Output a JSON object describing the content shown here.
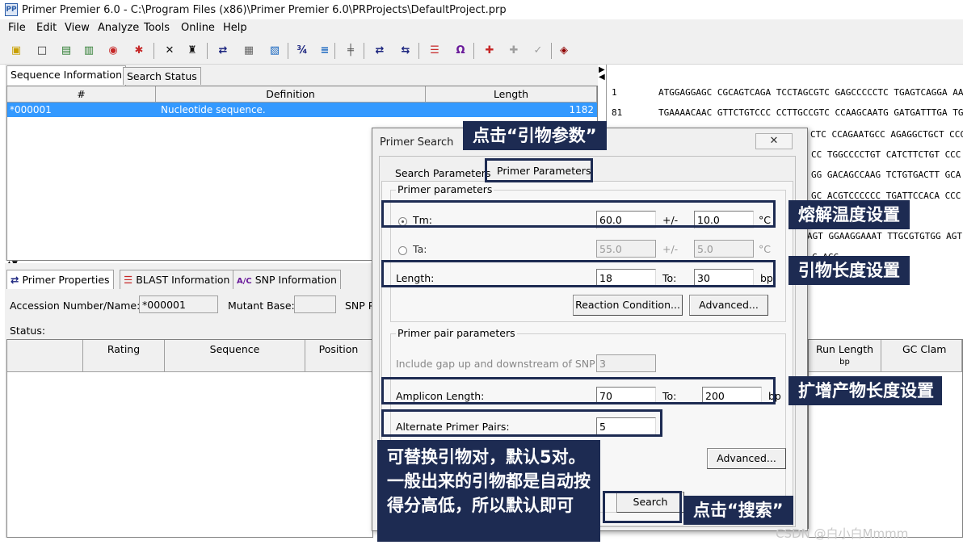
{
  "window": {
    "title": "Primer Premier 6.0 - C:\\Program Files (x86)\\Primer Premier 6.0\\PRProjects\\DefaultProject.prp",
    "app_icon_label": "PP"
  },
  "menu": [
    "File",
    "Edit",
    "View",
    "Analyze",
    "Tools",
    "Online",
    "Help"
  ],
  "toolbar_icons": [
    {
      "name": "open-folder-icon",
      "glyph": "▣",
      "color": "#c8a000"
    },
    {
      "name": "new-file-icon",
      "glyph": "□",
      "color": "#333333"
    },
    {
      "name": "open-icon",
      "glyph": "▤",
      "color": "#2e7d32"
    },
    {
      "name": "save-icon",
      "glyph": "▥",
      "color": "#2e7d32"
    },
    {
      "name": "genbank-icon",
      "glyph": "◉",
      "color": "#c62828"
    },
    {
      "name": "snp-db-icon",
      "glyph": "✱",
      "color": "#c62828"
    },
    {
      "name": "delete-icon",
      "glyph": "✕",
      "color": "#111111"
    },
    {
      "name": "find-icon",
      "glyph": "♜",
      "color": "#111111"
    },
    {
      "name": "align-icon",
      "glyph": "⇄",
      "color": "#1a237e"
    },
    {
      "name": "edit-seq-icon",
      "glyph": "▦",
      "color": "#666666"
    },
    {
      "name": "translate-icon",
      "glyph": "▧",
      "color": "#1565c0"
    },
    {
      "name": "ratio-icon",
      "glyph": "¾",
      "color": "#1a237e"
    },
    {
      "name": "gag-ctg-icon",
      "glyph": "≡",
      "color": "#1565c0"
    },
    {
      "name": "tree-icon",
      "glyph": "╪",
      "color": "#555555"
    },
    {
      "name": "primer-pair-icon",
      "glyph": "⇄",
      "color": "#1a237e"
    },
    {
      "name": "primer-search-icon",
      "glyph": "⇆",
      "color": "#1a237e"
    },
    {
      "name": "blast-icon",
      "glyph": "☰",
      "color": "#c62828"
    },
    {
      "name": "snp-analysis-icon",
      "glyph": "Ω",
      "color": "#6a1b9a"
    },
    {
      "name": "snp-red-icon",
      "glyph": "✚",
      "color": "#c62828"
    },
    {
      "name": "snp-gray-icon",
      "glyph": "✚",
      "color": "#9e9e9e"
    },
    {
      "name": "snp-check-icon",
      "glyph": "✓",
      "color": "#9e9e9e"
    },
    {
      "name": "book-icon",
      "glyph": "◈",
      "color": "#8e0000"
    }
  ],
  "seq_info": {
    "tabs": [
      "Sequence Information",
      "Search Status"
    ],
    "columns": [
      "#",
      "Definition",
      "Length"
    ],
    "rows": [
      {
        "id": "*000001",
        "definition": "Nucleotide sequence.",
        "length": "1182"
      }
    ]
  },
  "sequence_view": {
    "lines": [
      {
        "pos": "1",
        "seq": "ATGGAGGAGC CGCAGTCAGA TCCTAGCGTC GAGCCCCCTC TGAGTCAGGA AAC"
      },
      {
        "pos": "81",
        "seq": "TGAAAACAAC GTTCTGTCCC CCTTGCCGTC CCAAGCAATG GATGATTTGA TGC"
      },
      {
        "pos": "",
        "seq": "CTC CCAGAATGCC AGAGGCTGCT CCC"
      },
      {
        "pos": "",
        "seq": "CC TGGCCCCTGT CATCTTCTGT CCC"
      },
      {
        "pos": "",
        "seq": "GG GACAGCCAAG TCTGTGACTT GCA"
      },
      {
        "pos": "",
        "seq": "GC ACGTCCCCCC TGATTCCACA CCC"
      },
      {
        "pos": "",
        "seq": "CC"
      },
      {
        "pos": "",
        "seq": "AGT GGAAGGAAAT TTGCGTGTGG AGT"
      },
      {
        "pos": "",
        "seq": "C ACC"
      }
    ]
  },
  "primer_panel": {
    "tabs": [
      "Primer Properties",
      "BLAST Information",
      "SNP Information"
    ],
    "accession_label": "Accession Number/Name:",
    "accession_value": "*000001",
    "mutant_label": "Mutant Base:",
    "snp_label": "SNP P",
    "status_label": "Status:",
    "columns": [
      "Rating",
      "Sequence",
      "Position"
    ]
  },
  "right_grid": {
    "columns": [
      {
        "label": "Run Length",
        "unit": "bp"
      },
      {
        "label": "GC Clam",
        "unit": ""
      }
    ]
  },
  "dialog": {
    "title": "Primer Search",
    "close_glyph": "✕",
    "tabs": [
      "Search Parameters",
      "Primer Parameters"
    ],
    "primer_group_title": "Primer parameters",
    "tm": {
      "label": "Tm:",
      "value": "60.0",
      "pm": "+/-",
      "tol": "10.0",
      "unit": "°C"
    },
    "ta": {
      "label": "Ta:",
      "value": "55.0",
      "pm": "+/-",
      "tol": "5.0",
      "unit": "°C"
    },
    "length": {
      "label": "Length:",
      "from": "18",
      "to_label": "To:",
      "to": "30",
      "unit": "bp"
    },
    "reaction_button": "Reaction Condition...",
    "advanced_button": "Advanced...",
    "pair_group_title": "Primer pair parameters",
    "gap": {
      "label": "Include gap up and downstream of SNP:",
      "value": "3"
    },
    "amplicon": {
      "label": "Amplicon Length:",
      "from": "70",
      "to_label": "To:",
      "to": "200",
      "unit": "bp"
    },
    "alternate": {
      "label": "Alternate Primer Pairs:",
      "value": "5"
    },
    "advanced_button2": "Advanced...",
    "search_button": "Search"
  },
  "annotations": {
    "primer_params": "点击“引物参数”",
    "tm": "熔解温度设置",
    "length": "引物长度设置",
    "amplicon": "扩增产物长度设置",
    "alternate": "可替换引物对，默认5对。一般出来的引物都是自动按得分高低，所以默认即可",
    "search": "点击“搜索”"
  },
  "watermark": "CSDN @白小白Mmmm",
  "colors": {
    "annotation_bg": "#1d2b52",
    "selection": "#3399ff"
  }
}
